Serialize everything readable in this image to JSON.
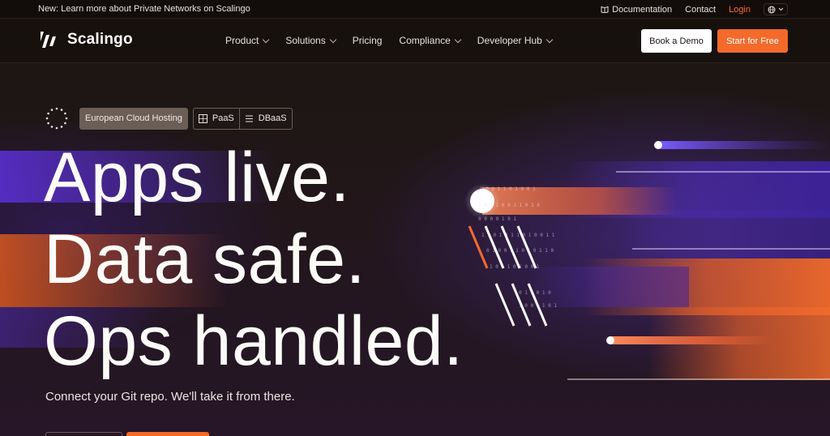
{
  "topbar": {
    "announcement": "New: Learn more about Private Networks on Scalingo",
    "documentation": "Documentation",
    "contact": "Contact",
    "login": "Login"
  },
  "nav": {
    "brand": "Scalingo",
    "menu": [
      {
        "label": "Product",
        "has_dropdown": true
      },
      {
        "label": "Solutions",
        "has_dropdown": true
      },
      {
        "label": "Pricing",
        "has_dropdown": false
      },
      {
        "label": "Compliance",
        "has_dropdown": true
      },
      {
        "label": "Developer Hub",
        "has_dropdown": true
      }
    ],
    "book_demo": "Book a Demo",
    "start_free": "Start for Free"
  },
  "hero": {
    "badge_primary": "European Cloud Hosting",
    "badge_paas": "PaaS",
    "badge_dbaas": "DBaaS",
    "headline": [
      "Apps live.",
      "Data safe.",
      "Ops handled."
    ],
    "subtitle": "Connect your Git repo. We'll take it from there."
  },
  "colors": {
    "accent": "#f36a2a",
    "background": "#1b1411",
    "purple": "#5330b4"
  },
  "icons": [
    "book-icon",
    "globe-icon",
    "chevron-down-icon",
    "logo-mark-icon",
    "spinner-dots-icon",
    "grid-icon",
    "list-icon"
  ]
}
